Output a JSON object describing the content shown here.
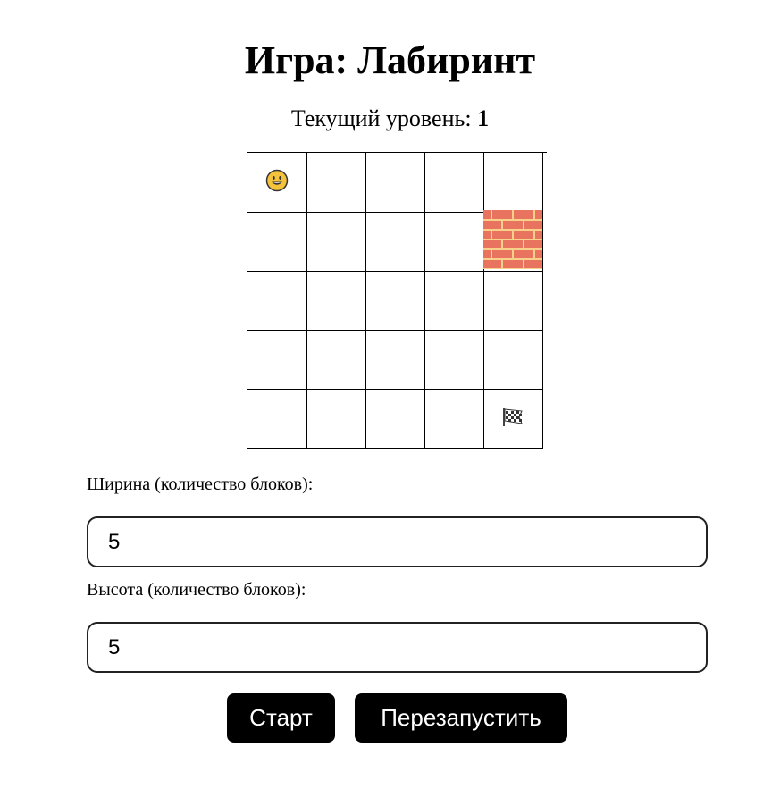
{
  "title": "Игра: Лабиринт",
  "level": {
    "label": "Текущий уровень: ",
    "value": "1"
  },
  "maze": {
    "rows": 5,
    "cols": 5,
    "player": {
      "row": 0,
      "col": 0,
      "icon": "smiley-face-icon"
    },
    "walls": [
      {
        "row": 1,
        "col": 4,
        "icon": "brick-wall-icon"
      }
    ],
    "finish": {
      "row": 4,
      "col": 4,
      "icon": "checkered-flag-icon"
    }
  },
  "width_field": {
    "label": "Ширина (количество блоков):",
    "value": "5"
  },
  "height_field": {
    "label": "Высота (количество блоков):",
    "value": "5"
  },
  "buttons": {
    "start": "Старт",
    "restart": "Перезапустить"
  },
  "colors": {
    "button_bg": "#000000",
    "button_text": "#ffffff",
    "brick": "#e8735f",
    "mortar": "#f7d18a",
    "smiley": "#f5c33b"
  }
}
